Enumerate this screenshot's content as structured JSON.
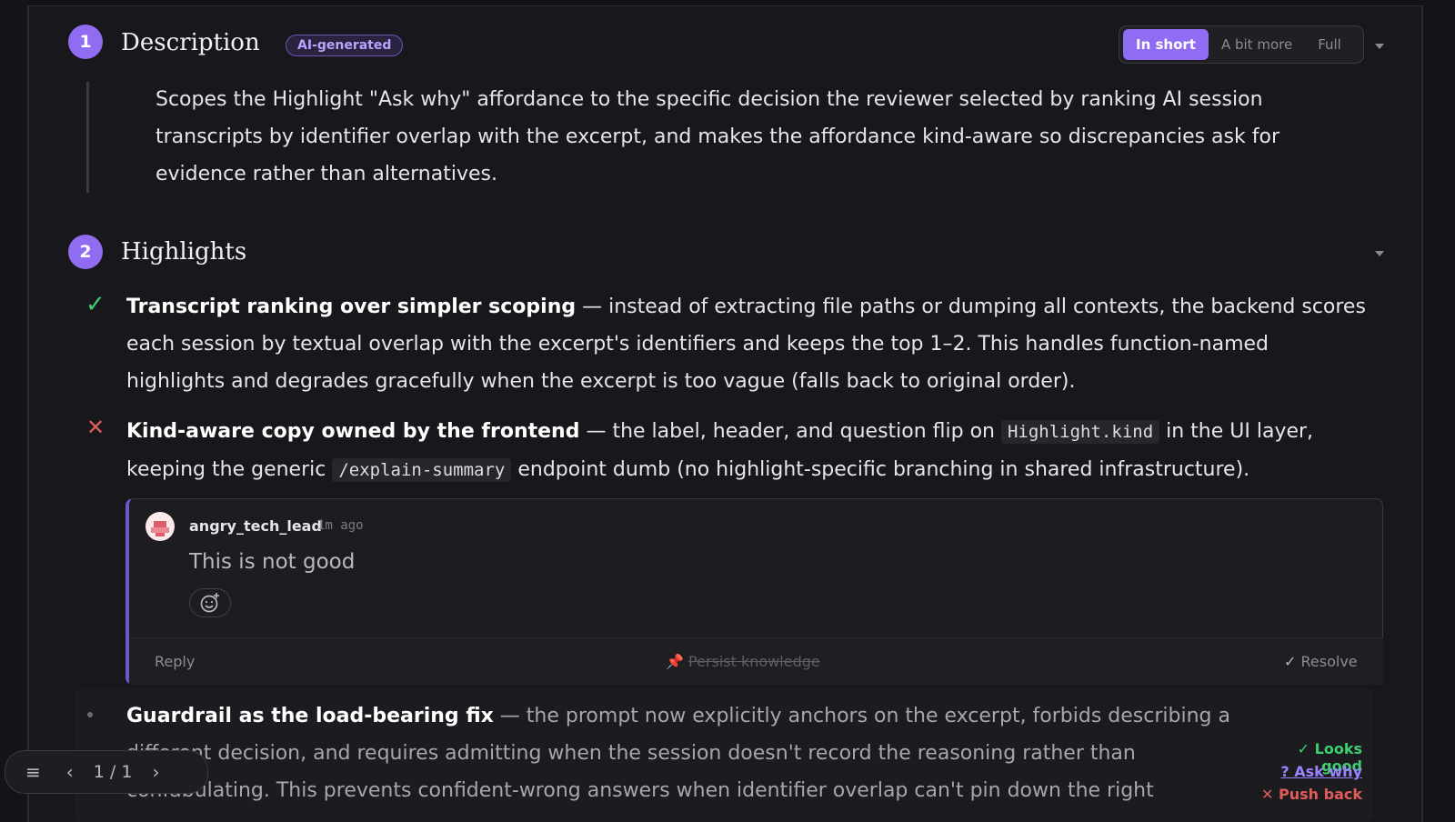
{
  "colors": {
    "accent": "#8f6cf1",
    "success": "#3ecf6e",
    "danger": "#e25c5c",
    "link": "#9b84ff"
  },
  "description": {
    "number": "1",
    "title": "Description",
    "badge": "AI-generated",
    "tabs": [
      "In short",
      "A bit more",
      "Full"
    ],
    "active_tab": "In short",
    "lines": [
      "Scopes the Highlight \"Ask why\" affordance to the specific decision the reviewer selected by ranking AI session",
      "transcripts by identifier overlap with the excerpt, and makes the affordance kind-aware so discrepancies ask for",
      "evidence rather than alternatives."
    ]
  },
  "highlights": {
    "number": "2",
    "title": "Highlights",
    "item1": {
      "status": "check-icon",
      "title": "Transcript ranking over simpler scoping",
      "line1": " — instead of extracting file paths or dumping all contexts, the backend scores",
      "line2": "each session by textual overlap with the excerpt's identifiers and keeps the top 1–2. This handles function-named",
      "line3": "highlights and degrades gracefully when the excerpt is too vague (falls back to original order)."
    },
    "item2": {
      "status": "x-icon",
      "title": "Kind-aware copy owned by the frontend",
      "line1a": " — the label, header, and question flip on ",
      "code1": "Highlight.kind",
      "line1b": " in the UI layer,",
      "line2a": "keeping the generic ",
      "code2": "/explain-summary",
      "line2b": " endpoint dumb (no highlight-specific branching in shared infrastructure)."
    },
    "comment": {
      "user": "angry_tech_lead",
      "time": "1m ago",
      "body": "This is not good",
      "reply": "Reply",
      "persist": "Persist knowledge",
      "resolve": "Resolve"
    },
    "item3": {
      "title": "Guardrail as the load-bearing fix",
      "line1": " — the prompt now explicitly anchors on the excerpt, forbids describing a",
      "line2": "different decision, and requires admitting when the session doesn't record the reasoning rather than",
      "line3": "confabulating. This prevents confident-wrong answers when identifier overlap can't pin down the right"
    },
    "actions": {
      "looks_good": "Looks good",
      "ask_why": "? Ask why",
      "push_back": "Push back"
    }
  },
  "pager": {
    "text": "1 / 1"
  }
}
